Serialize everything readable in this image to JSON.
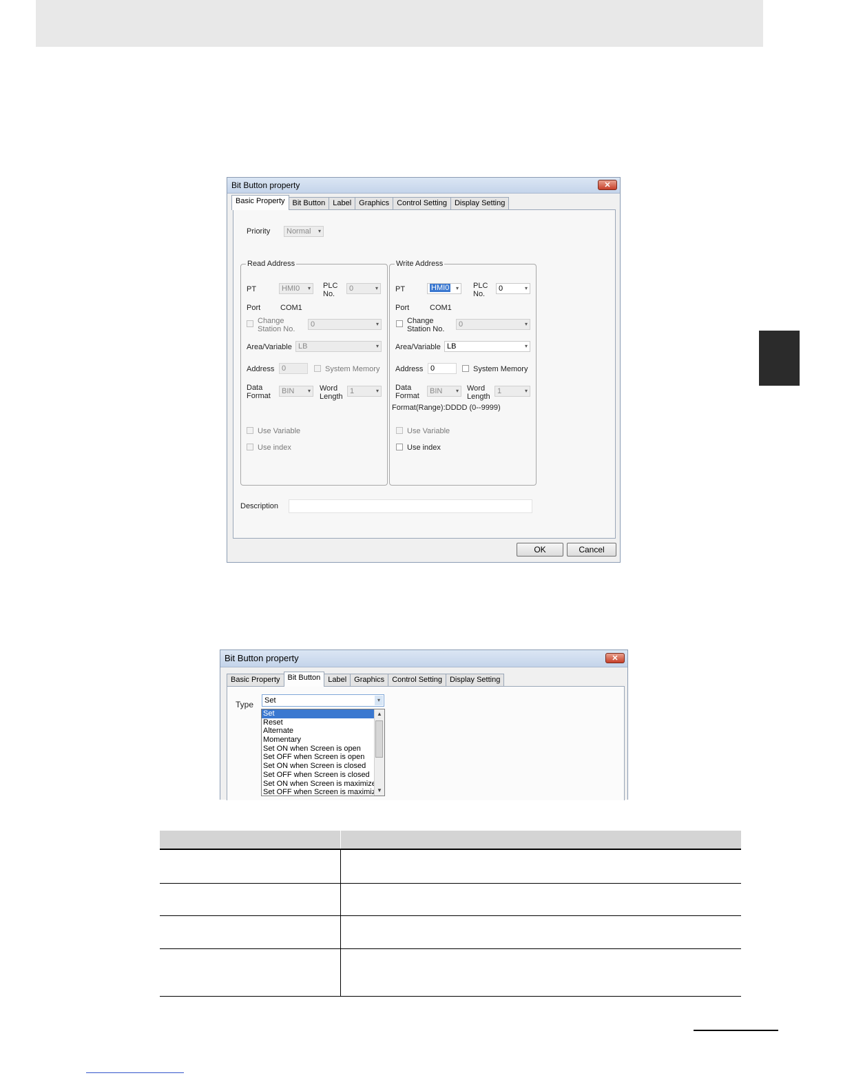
{
  "dialog1": {
    "title": "Bit Button property",
    "close_glyph": "✕",
    "tabs": [
      "Basic Property",
      "Bit Button",
      "Label",
      "Graphics",
      "Control Setting",
      "Display Setting"
    ],
    "priority": {
      "label": "Priority",
      "value": "Normal"
    },
    "read": {
      "title": "Read Address",
      "pt_label": "PT",
      "pt_value": "HMI0",
      "plc_label_1": "PLC",
      "plc_label_2": "No.",
      "plc_value": "0",
      "port_label": "Port",
      "port_value": "COM1",
      "change_1": "Change",
      "change_2": "Station No.",
      "station_value": "0",
      "area_label": "Area/Variable",
      "area_value": "LB",
      "address_label": "Address",
      "address_value": "0",
      "sysmem_label": "System Memory",
      "data_1": "Data",
      "data_2": "Format",
      "format_value": "BIN",
      "word_1": "Word",
      "word_2": "Length",
      "length_value": "1",
      "use_variable": "Use Variable",
      "use_index": "Use index"
    },
    "write": {
      "title": "Write Address",
      "pt_label": "PT",
      "pt_value": "HMI0",
      "plc_label_1": "PLC",
      "plc_label_2": "No.",
      "plc_value": "0",
      "port_label": "Port",
      "port_value": "COM1",
      "change_1": "Change",
      "change_2": "Station No.",
      "station_value": "0",
      "area_label": "Area/Variable",
      "area_value": "LB",
      "address_label": "Address",
      "address_value": "0",
      "sysmem_label": "System Memory",
      "data_1": "Data",
      "data_2": "Format",
      "format_value": "BIN",
      "word_1": "Word",
      "word_2": "Length",
      "length_value": "1",
      "range_text": "Format(Range):DDDD (0--9999)",
      "use_variable": "Use Variable",
      "use_index": "Use index"
    },
    "description_label": "Description",
    "ok_label": "OK",
    "cancel_label": "Cancel"
  },
  "dialog2": {
    "title": "Bit Button property",
    "close_glyph": "✕",
    "tabs": [
      "Basic Property",
      "Bit Button",
      "Label",
      "Graphics",
      "Control Setting",
      "Display Setting"
    ],
    "type_label": "Type",
    "type_value": "Set",
    "type_options": [
      "Set",
      "Reset",
      "Alternate",
      "Momentary",
      "Set ON when Screen is open",
      "Set OFF when Screen is open",
      "Set ON when Screen is closed",
      "Set OFF when Screen is closed",
      "Set ON when Screen is maximized",
      "Set OFF when Screen is maximized"
    ]
  },
  "icons": {
    "dropdown_arrow": "▾",
    "scroll_up": "▲",
    "scroll_down": "▼",
    "grip": "≡"
  }
}
